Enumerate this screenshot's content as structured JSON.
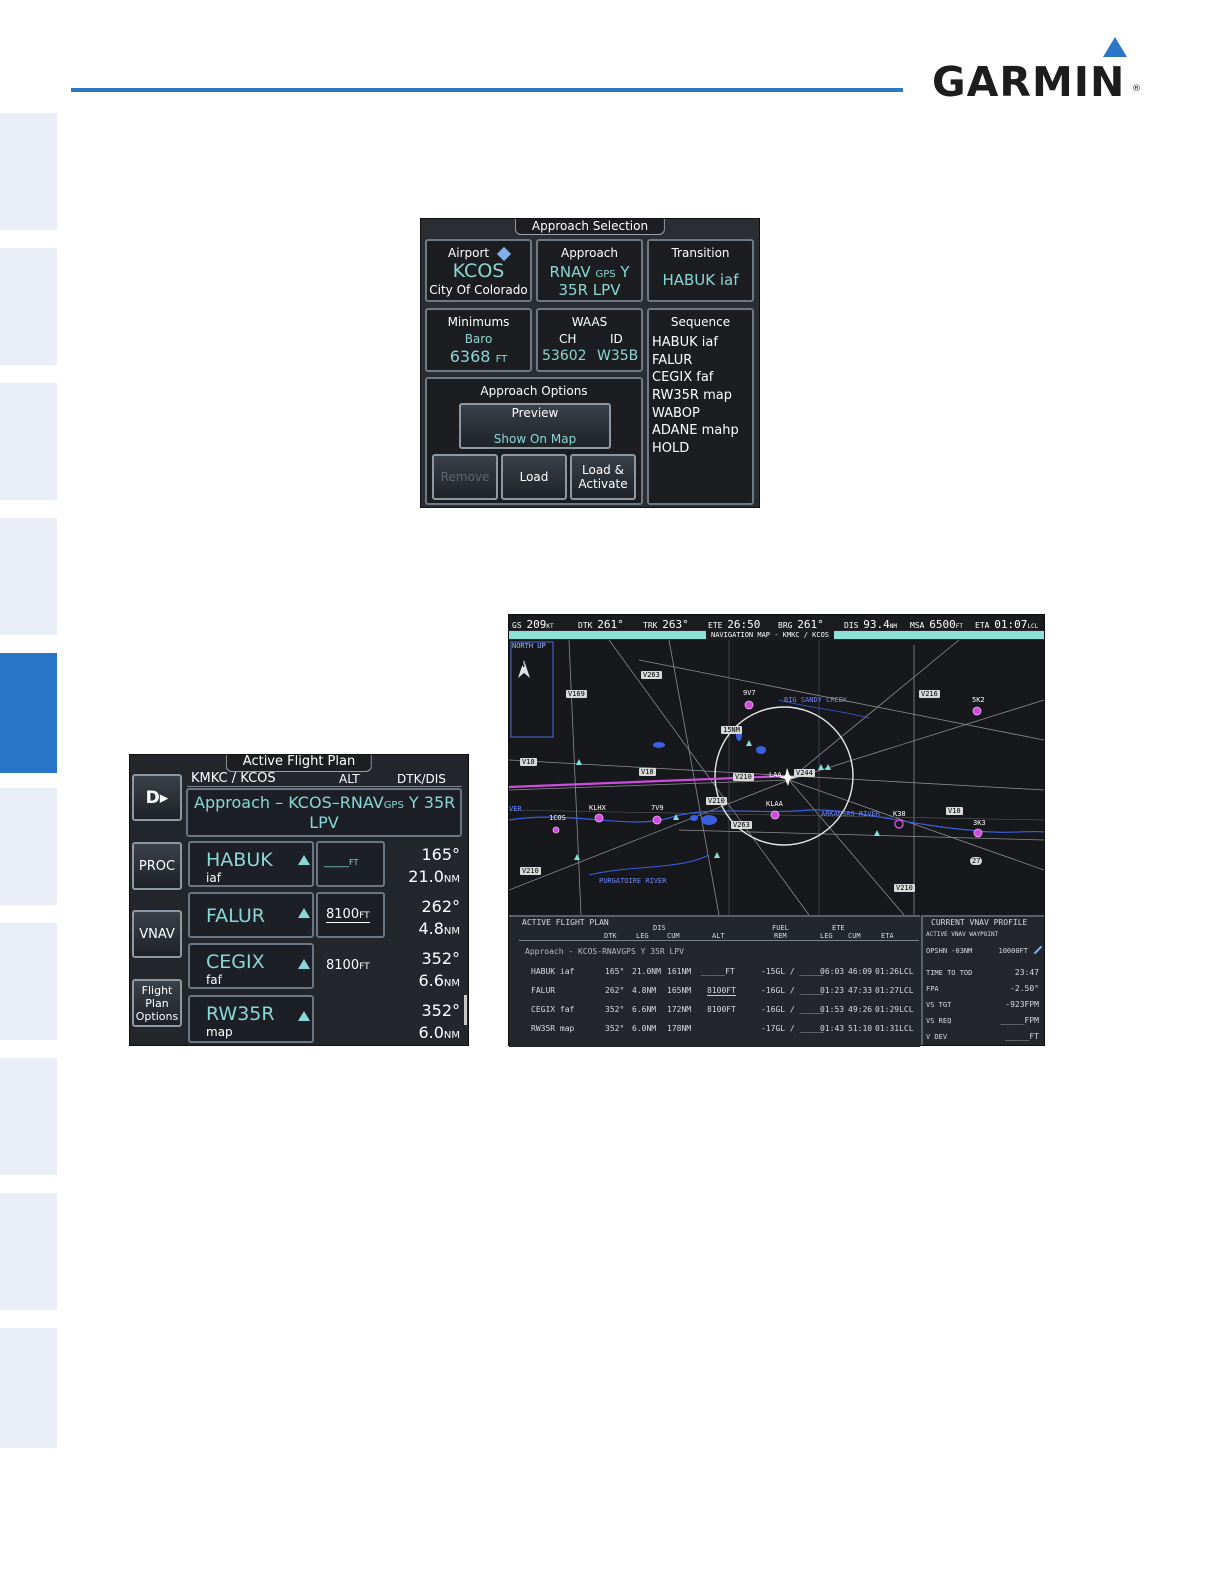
{
  "brand": {
    "name": "GARMIN",
    "reg": "®",
    "accent": "#2b76c6"
  },
  "approach_selection": {
    "title": "Approach Selection",
    "airport": {
      "label": "Airport",
      "ident": "KCOS",
      "name": "City Of Colorado"
    },
    "approach": {
      "label": "Approach",
      "line1_a": "RNAV",
      "line1_gps": "GPS",
      "line1_b": "Y",
      "line2": "35R LPV"
    },
    "transition": {
      "label": "Transition",
      "value": "HABUK iaf"
    },
    "minimums": {
      "label": "Minimums",
      "type": "Baro",
      "value": "6368",
      "unit": "FT"
    },
    "waas": {
      "label": "WAAS",
      "ch_label": "CH",
      "id_label": "ID",
      "ch": "53602",
      "id": "W35B"
    },
    "sequence": {
      "label": "Sequence",
      "items": [
        "HABUK iaf",
        "FALUR",
        "CEGIX faf",
        "RW35R map",
        "WABOP",
        "ADANE mahp",
        "HOLD"
      ]
    },
    "options": {
      "label": "Approach Options",
      "preview_label": "Preview",
      "show_on_map": "Show On Map",
      "remove": "Remove",
      "load": "Load",
      "load_activate_1": "Load &",
      "load_activate_2": "Activate"
    }
  },
  "active_flight_plan": {
    "title": "Active Flight Plan",
    "route": "KMKC / KCOS",
    "col_alt": "ALT",
    "col_dtkdis": "DTK/DIS",
    "approach_line1_a": "Approach – KCOS–RNAV",
    "approach_line1_gps": "GPS",
    "approach_line1_b": "Y 35R",
    "approach_line2": "LPV",
    "softkeys": {
      "direct": "D▸",
      "proc": "PROC",
      "vnav": "VNAV",
      "fpo_1": "Flight",
      "fpo_2": "Plan",
      "fpo_3": "Options"
    },
    "rows": [
      {
        "name": "HABUK",
        "sub": "iaf",
        "alt": "_____",
        "alt_unit": "FT",
        "dtk": "165°",
        "dis": "21.0",
        "dis_unit": "NM"
      },
      {
        "name": "FALUR",
        "sub": "",
        "alt": "8100",
        "alt_unit": "FT",
        "dtk": "262°",
        "dis": "4.8",
        "dis_unit": "NM"
      },
      {
        "name": "CEGIX",
        "sub": "faf",
        "alt": "8100",
        "alt_unit": "FT",
        "dtk": "352°",
        "dis": "6.6",
        "dis_unit": "NM"
      },
      {
        "name": "RW35R",
        "sub": "map",
        "alt": "",
        "alt_unit": "",
        "dtk": "352°",
        "dis": "6.0",
        "dis_unit": "NM"
      }
    ]
  },
  "nav_map": {
    "topbar": {
      "gs_lbl": "GS",
      "gs": "209",
      "gs_unit": "KT",
      "dtk_lbl": "DTK",
      "dtk": "261°",
      "trk_lbl": "TRK",
      "trk": "263°",
      "ete_lbl": "ETE",
      "ete": "26:50",
      "brg_lbl": "BRG",
      "brg": "261°",
      "dis_lbl": "DIS",
      "dis": "93.4",
      "dis_unit": "NM",
      "msa_lbl": "MSA",
      "msa": "6500",
      "msa_unit": "FT",
      "eta_lbl": "ETA",
      "eta": "01:07",
      "eta_unit": "LCL"
    },
    "title": "NAVIGATION MAP - KMKC / KCOS",
    "orientation": "NORTH UP",
    "north": "N",
    "labels": {
      "v263a": "V263",
      "v169": "V169",
      "v216": "V216",
      "v10a": "V10",
      "v10b": "V10",
      "v10c": "V10",
      "v210a": "V210",
      "v210b": "V210",
      "v210c": "V210",
      "v263b": "V263",
      "v244": "V244",
      "big_sandy": "BIG SANDY CREEK",
      "arkansas": "ARKANSAS RIVER",
      "purgatoire": "PURGATOIRE RIVER",
      "ap_9v7": "9V7",
      "ap_5k2": "5K2",
      "ap_klhx": "KLHX",
      "ap_7v9": "7V9",
      "ap_klaa": "KLAA",
      "ap_k38": "K38",
      "ap_3k3": "3K3",
      "ap_1cos": "1COS",
      "ap_laa": "LAA",
      "range": "15NM",
      "rr": "27",
      "ver": "VER"
    },
    "afp": {
      "title": "ACTIVE FLIGHT PLAN",
      "h_dis": "DIS",
      "h_fuel": "FUEL",
      "h_ete": "ETE",
      "h_dtk": "DTK",
      "h_leg": "LEG",
      "h_cum": "CUM",
      "h_alt": "ALT",
      "h_rem": "REM",
      "h_leg2": "LEG",
      "h_cum2": "CUM",
      "h_eta": "ETA",
      "approach": "Approach - KCOS-RNAVGPS Y 35R LPV",
      "rows": [
        {
          "name": "HABUK iaf",
          "dtk": "165°",
          "leg": "21.0NM",
          "cum": "161NM",
          "alt": "_____FT",
          "rem": "-15GL / _____",
          "ete_leg": "06:03",
          "ete_cum": "46:09",
          "eta": "01:26LCL"
        },
        {
          "name": "FALUR",
          "dtk": "262°",
          "leg": "4.8NM",
          "cum": "165NM",
          "alt": "8100FT",
          "rem": "-16GL / _____",
          "ete_leg": "01:23",
          "ete_cum": "47:33",
          "eta": "01:27LCL"
        },
        {
          "name": "CEGIX faf",
          "dtk": "352°",
          "leg": "6.6NM",
          "cum": "172NM",
          "alt": "8100FT",
          "rem": "-16GL / _____",
          "ete_leg": "01:53",
          "ete_cum": "49:26",
          "eta": "01:29LCL"
        },
        {
          "name": "RW35R map",
          "dtk": "352°",
          "leg": "6.0NM",
          "cum": "178NM",
          "alt": "",
          "rem": "-17GL / _____",
          "ete_leg": "01:43",
          "ete_cum": "51:10",
          "eta": "01:31LCL"
        }
      ]
    },
    "vnav": {
      "title": "CURRENT VNAV PROFILE",
      "sub": "ACTIVE VNAV WAYPOINT",
      "wpt": "OPSHN -03NM",
      "wpt_alt": "10000FT",
      "items": [
        {
          "k": "TIME TO TOD",
          "v": "23:47"
        },
        {
          "k": "FPA",
          "v": "-2.50°"
        },
        {
          "k": "VS TGT",
          "v": "-923FPM"
        },
        {
          "k": "VS REQ",
          "v": "_____FPM"
        },
        {
          "k": "V DEV",
          "v": "_____FT"
        }
      ]
    }
  }
}
